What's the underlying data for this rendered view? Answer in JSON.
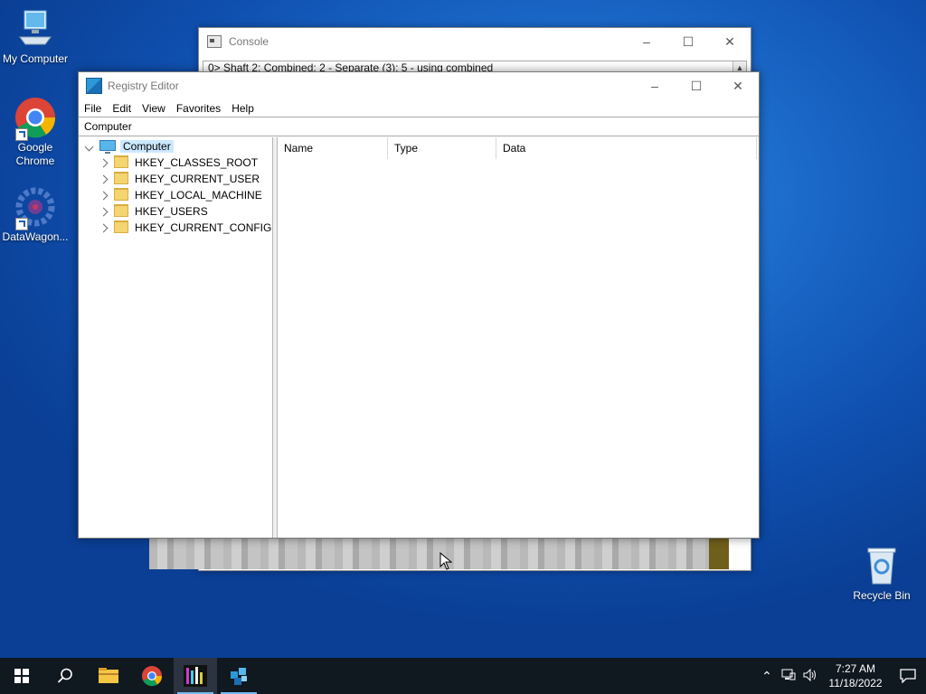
{
  "desktop": {
    "icons": [
      {
        "label": "My Computer"
      },
      {
        "label": "Google Chrome"
      },
      {
        "label": "DataWagon..."
      },
      {
        "label": "Recycle Bin"
      }
    ]
  },
  "console": {
    "title": "Console",
    "line": "0> Shaft 2: Combined: 2 - Separate (3): 5 - using combined"
  },
  "regedit": {
    "title": "Registry Editor",
    "menu": [
      "File",
      "Edit",
      "View",
      "Favorites",
      "Help"
    ],
    "address": "Computer",
    "tree": {
      "root": "Computer",
      "keys": [
        "HKEY_CLASSES_ROOT",
        "HKEY_CURRENT_USER",
        "HKEY_LOCAL_MACHINE",
        "HKEY_USERS",
        "HKEY_CURRENT_CONFIG"
      ]
    },
    "columns": [
      "Name",
      "Type",
      "Data"
    ]
  },
  "taskbar": {
    "time": "7:27 AM",
    "date": "11/18/2022"
  },
  "colors": {
    "desktop": "#1a68c8",
    "taskbar": "#101820",
    "selection": "#cce8ff"
  }
}
